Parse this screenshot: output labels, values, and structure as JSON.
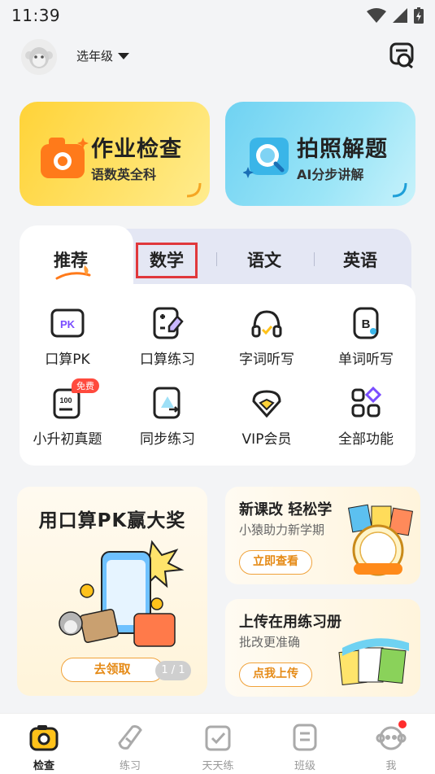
{
  "status_bar": {
    "time": "11:39"
  },
  "header": {
    "grade_label": "选年级"
  },
  "cards": [
    {
      "title": "作业检查",
      "subtitle": "语数英全科"
    },
    {
      "title": "拍照解题",
      "subtitle": "AI分步讲解"
    }
  ],
  "tabs": [
    {
      "label": "推荐"
    },
    {
      "label": "数学"
    },
    {
      "label": "语文"
    },
    {
      "label": "英语"
    }
  ],
  "features": [
    {
      "label": "口算PK",
      "icon": "pk-icon",
      "icon_text": "PK"
    },
    {
      "label": "口算练习",
      "icon": "calculator-pencil-icon"
    },
    {
      "label": "字词听写",
      "icon": "headphones-icon"
    },
    {
      "label": "单词听写",
      "icon": "letter-b-icon",
      "icon_text": "B"
    },
    {
      "label": "小升初真题",
      "icon": "exam-paper-icon",
      "badge": "免费",
      "icon_text": "100"
    },
    {
      "label": "同步练习",
      "icon": "sync-practice-icon"
    },
    {
      "label": "VIP会员",
      "icon": "vip-crown-icon"
    },
    {
      "label": "全部功能",
      "icon": "all-features-icon"
    }
  ],
  "promo_big": {
    "title": "用口算PK赢大奖",
    "button": "去领取",
    "pager": "1 / 1"
  },
  "promo_small": [
    {
      "title": "新课改 轻松学",
      "subtitle": "小猿助力新学期",
      "button": "立即查看"
    },
    {
      "title": "上传在用练习册",
      "subtitle": "批改更准确",
      "button": "点我上传"
    }
  ],
  "bottom_nav": [
    {
      "label": "检查",
      "active": true
    },
    {
      "label": "练习"
    },
    {
      "label": "天天练"
    },
    {
      "label": "班级"
    },
    {
      "label": "我"
    }
  ],
  "colors": {
    "accent_orange": "#e58a16",
    "highlight_red": "#e0383c",
    "yellow_card": "#ffd338",
    "blue_card": "#6fd2f2"
  }
}
